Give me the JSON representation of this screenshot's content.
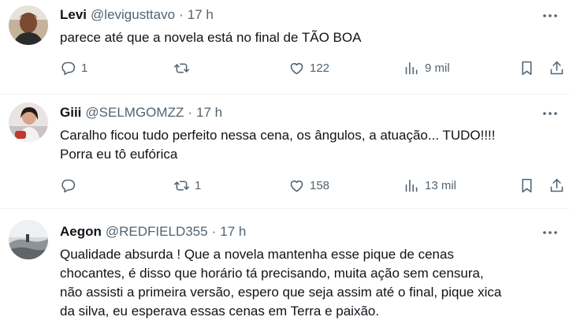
{
  "tweets": [
    {
      "name": "Levi",
      "handle": "@levigusttavo",
      "time": "17 h",
      "text": "parece até que a novela está no final de TÃO BOA",
      "replies": "1",
      "retweets": "",
      "likes": "122",
      "views": "9 mil"
    },
    {
      "name": "Giii",
      "handle": "@SELMGOMZZ",
      "time": "17 h",
      "text": "Caralho ficou tudo perfeito nessa cena, os ângulos, a atuação... TUDO!!!!\nPorra eu tô eufórica",
      "replies": "",
      "retweets": "1",
      "likes": "158",
      "views": "13 mil"
    },
    {
      "name": "Aegon",
      "handle": "@REDFIELD355",
      "time": "17 h",
      "text": "Qualidade absurda ! Que a novela mantenha esse pique de cenas\nchocantes, é disso que horário tá precisando, muita ação sem censura,\nnão assisti a primeira versão, espero que seja assim até o final, pique xica\nda silva, eu esperava essas cenas em Terra e paixão.",
      "replies": "",
      "retweets": "",
      "likes": "",
      "views": ""
    }
  ],
  "separator": "·",
  "colors": {
    "text": "#0f1419",
    "secondary": "#536471",
    "divider": "#eff3f4"
  },
  "icons": [
    "more-icon",
    "reply-icon",
    "retweet-icon",
    "like-icon",
    "views-icon",
    "bookmark-icon",
    "share-icon"
  ]
}
